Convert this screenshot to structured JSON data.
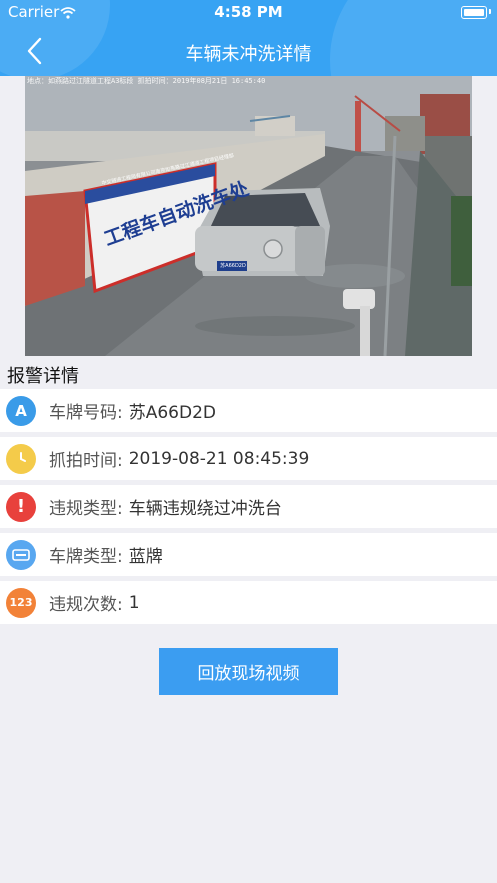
{
  "status_bar": {
    "carrier": "Carrier",
    "time": "4:58 PM"
  },
  "nav": {
    "title": "车辆未冲洗详情",
    "back_icon": "chevron-left-icon"
  },
  "photo": {
    "stamp": "地点：如燕路过江隧道工程A3标段  抓拍时间：2019年08月21日  16:45:40",
    "sign_text": "工程车自动洗车处",
    "plate_text": "苏A66D2D",
    "top_banner": "中交隧道工程局有限公司南京如燕路过江通道工程项目经理部"
  },
  "section_title": "报警详情",
  "details": [
    {
      "label": "车牌号码:",
      "value": "苏A66D2D",
      "icon": "letter-a-icon",
      "glyph": "A",
      "color": "#3a9be8"
    },
    {
      "label": "抓拍时间:",
      "value": "2019-08-21 08:45:39",
      "icon": "clock-icon",
      "glyph": "",
      "color": "#f4cb4a"
    },
    {
      "label": "违规类型:",
      "value": "车辆违规绕过冲洗台",
      "icon": "alert-icon",
      "glyph": "!",
      "color": "#e8413c"
    },
    {
      "label": "车牌类型:",
      "value": "蓝牌",
      "icon": "plate-icon",
      "glyph": "",
      "color": "#58a7f0"
    },
    {
      "label": "违规次数:",
      "value": "1",
      "icon": "counter-123-icon",
      "glyph": "123",
      "color": "#f28238"
    }
  ],
  "action_button": {
    "label": "回放现场视频"
  }
}
